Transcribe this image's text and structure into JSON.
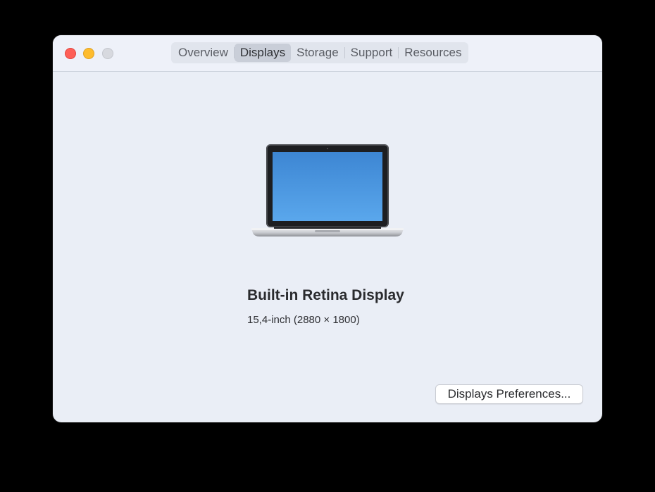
{
  "window": {
    "tabs": [
      {
        "label": "Overview",
        "active": false
      },
      {
        "label": "Displays",
        "active": true
      },
      {
        "label": "Storage",
        "active": false
      },
      {
        "label": "Support",
        "active": false
      },
      {
        "label": "Resources",
        "active": false
      }
    ]
  },
  "display": {
    "name": "Built-in Retina Display",
    "details": "15,4-inch (2880 × 1800)",
    "icon": "laptop-icon"
  },
  "buttons": {
    "preferences_label": "Displays Preferences..."
  },
  "colors": {
    "close": "#fe5f57",
    "minimize": "#febc2e",
    "zoom_disabled": "#d7d9df",
    "window_bg": "#eaeef6",
    "screen_blue": "#4a93dd"
  }
}
